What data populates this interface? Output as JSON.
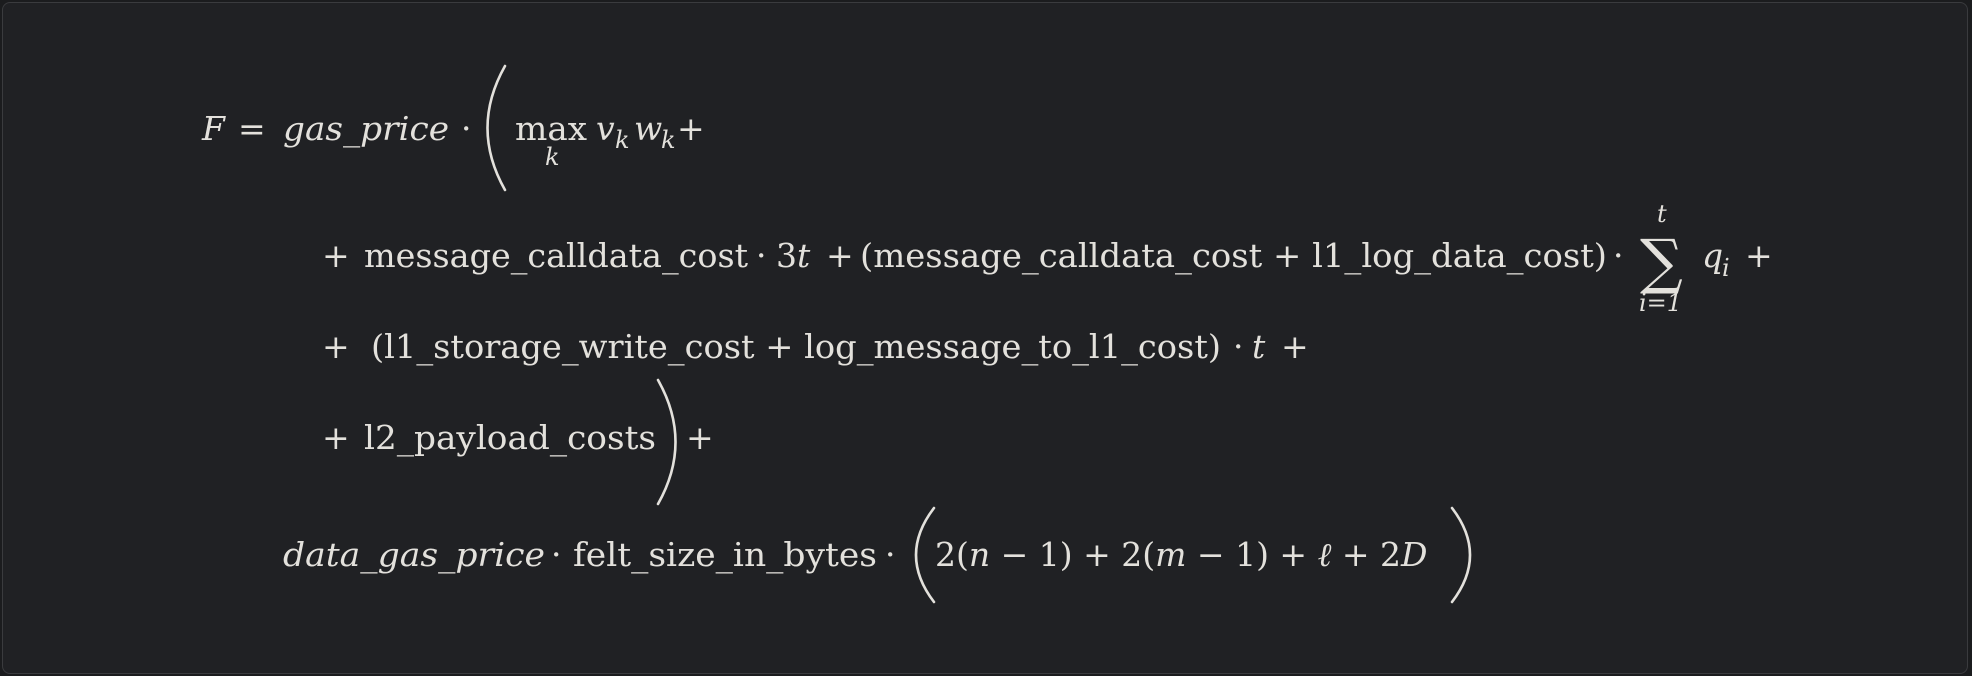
{
  "formula": {
    "line1": {
      "lhs": "F",
      "eq": "=",
      "gas_price": "gas_price",
      "cdot": "·",
      "max": "max",
      "max_sub": "k",
      "v": "v",
      "v_sub": "k",
      "w": "w",
      "w_sub": "k",
      "plus": "+"
    },
    "line2": {
      "lead_plus": "+",
      "term_a": "message_calldata_cost",
      "cdot": "·",
      "three": "3",
      "t": "t",
      "plus": "+",
      "group": "(message_calldata_cost + l1_log_data_cost)",
      "cdot2": "·",
      "sum": "∑",
      "sum_upper": "t",
      "sum_lower": "i=1",
      "q": "q",
      "q_sub": "i",
      "trail_plus": "+"
    },
    "line3": {
      "lead_plus": "+",
      "group": "(l1_storage_write_cost + log_message_to_l1_cost)",
      "cdot": "·",
      "t": "t",
      "trail_plus": "+"
    },
    "line4": {
      "lead_plus": "+",
      "term": "l2_payload_costs",
      "trail_plus": "+"
    },
    "line5": {
      "data_gas_price": "data_gas_price",
      "cdot": "·",
      "felt": "felt_size_in_bytes",
      "cdot2": "·",
      "a": "2(",
      "n": "n",
      "b": " − 1) + 2(",
      "m": "m",
      "c": " − 1) + ",
      "ell": "ℓ",
      "d": " + 2",
      "D": "D"
    }
  }
}
